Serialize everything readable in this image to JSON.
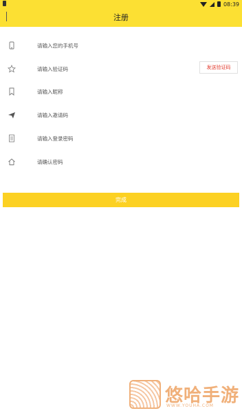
{
  "status_bar": {
    "time": "08:39"
  },
  "header": {
    "title": "注册"
  },
  "form": {
    "fields": [
      {
        "icon": "phone-icon",
        "placeholder": "请输入您的手机号"
      },
      {
        "icon": "star-icon",
        "placeholder": "请输入验证码"
      },
      {
        "icon": "bookmark-icon",
        "placeholder": "请输入昵称"
      },
      {
        "icon": "send-icon",
        "placeholder": "请输入邀请码"
      },
      {
        "icon": "document-icon",
        "placeholder": "请输入登录密码"
      },
      {
        "icon": "home-icon",
        "placeholder": "请确认密码"
      }
    ],
    "send_code_label": "发送验证码",
    "confirm_label": "完成"
  },
  "watermark": {
    "text": "悠哈手游",
    "url": "WWW.YOUHA.COM"
  },
  "colors": {
    "accent": "#fce033",
    "button": "#fcd123",
    "code_text": "#e23b2e"
  }
}
